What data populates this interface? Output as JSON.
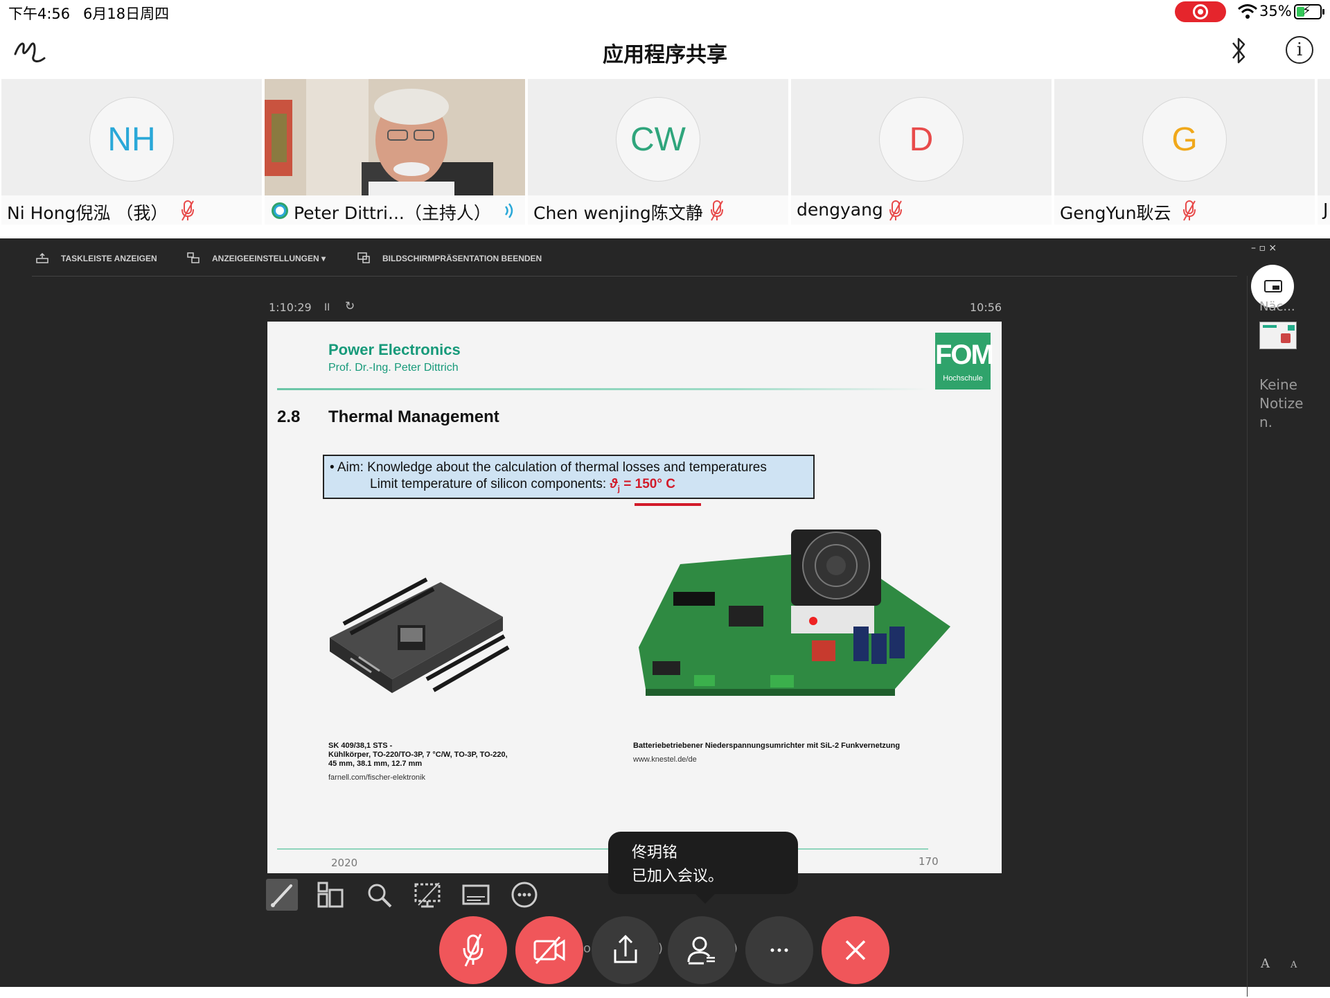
{
  "status_bar": {
    "time": "下午4:56",
    "date": "6月18日周四",
    "battery_percent": "35%",
    "battery_level": 0.35,
    "recording": true,
    "icons": [
      "record-icon",
      "wifi-icon",
      "battery-charging-icon"
    ]
  },
  "title_bar": {
    "title": "应用程序共享",
    "icons": [
      "annotate-icon",
      "bluetooth-icon",
      "info-icon"
    ],
    "info_glyph": "i"
  },
  "participants": [
    {
      "initials": "NH",
      "name": "Ni Hong倪泓 （我）",
      "color": "#2aa8d8",
      "muted": true
    },
    {
      "initials": "",
      "name": "Peter Dittri...（主持人）",
      "video": true,
      "speaking": true
    },
    {
      "initials": "CW",
      "name": "Chen wenjing陈文静",
      "color": "#2fa57c",
      "muted": true
    },
    {
      "initials": "D",
      "name": "dengyang",
      "color": "#e84b4b",
      "muted": true
    },
    {
      "initials": "G",
      "name": "GengYun耿云",
      "color": "#f0a81b",
      "muted": true
    },
    {
      "initials": "",
      "name": "J",
      "partial": true
    }
  ],
  "share_toolbar": {
    "show_taskbar": "TASKLEISTE ANZEIGEN",
    "display_settings": "ANZEIGEEINSTELLUNGEN ▾",
    "end_presentation": "BILDSCHIRMPRÄSENTATION BEENDEN",
    "window_controls": "–   ▫   ×"
  },
  "presenter": {
    "elapsed": "1:10:29",
    "pause": "II",
    "reset": "↻",
    "clock": "10:56",
    "next_label": "Näc...",
    "notes": "Keine Notizen.",
    "font_controls": [
      "A",
      "A"
    ]
  },
  "slide": {
    "header_title": "Power Electronics",
    "header_author": "Prof. Dr.-Ing. Peter Dittrich",
    "logo_main": "FOM",
    "logo_sub": "Hochschule",
    "section_number": "2.8",
    "section_title": "Thermal Management",
    "aim_line1": "• Aim: Knowledge about the calculation of thermal losses and temperatures",
    "aim_line2_prefix": "Limit temperature of silicon components: ",
    "aim_line2_symbol": "ϑ",
    "aim_line2_sub": "j",
    "aim_line2_value": " = 150° C",
    "caption_left_1": "SK 409/38,1 STS -",
    "caption_left_2": "Kühlkörper, TO-220/TO-3P, 7 °C/W, TO-3P, TO-220,",
    "caption_left_3": "45 mm, 38.1 mm, 12.7 mm",
    "caption_left_src": "farnell.com/fischer-elektronik",
    "caption_right": "Batteriebetriebener Niederspannungsumrichter mit SiL-2 Funkvernetzung",
    "caption_right_src": "www.knestel.de/de",
    "footer_year": "2020",
    "footer_page": "170"
  },
  "presenter_tools": [
    "pen-icon",
    "layout-icon",
    "zoom-icon",
    "blank-screen-icon",
    "subtitles-icon",
    "more-icon"
  ],
  "toast": {
    "name": "佟玥铭",
    "message": "已加入会议。"
  },
  "controls": {
    "mute": "mute-microphone-button",
    "video": "stop-video-button",
    "share": "share-button",
    "participants": "participants-button",
    "more": "···",
    "end": "leave-button",
    "behind_text_1": "o",
    "behind_text_2": ")",
    "behind_text_3": ")"
  },
  "colors": {
    "accent_red": "#f0565a",
    "slide_green": "#179a7a",
    "fom_green": "#2fa36b",
    "limit_red": "#d21b2a"
  }
}
